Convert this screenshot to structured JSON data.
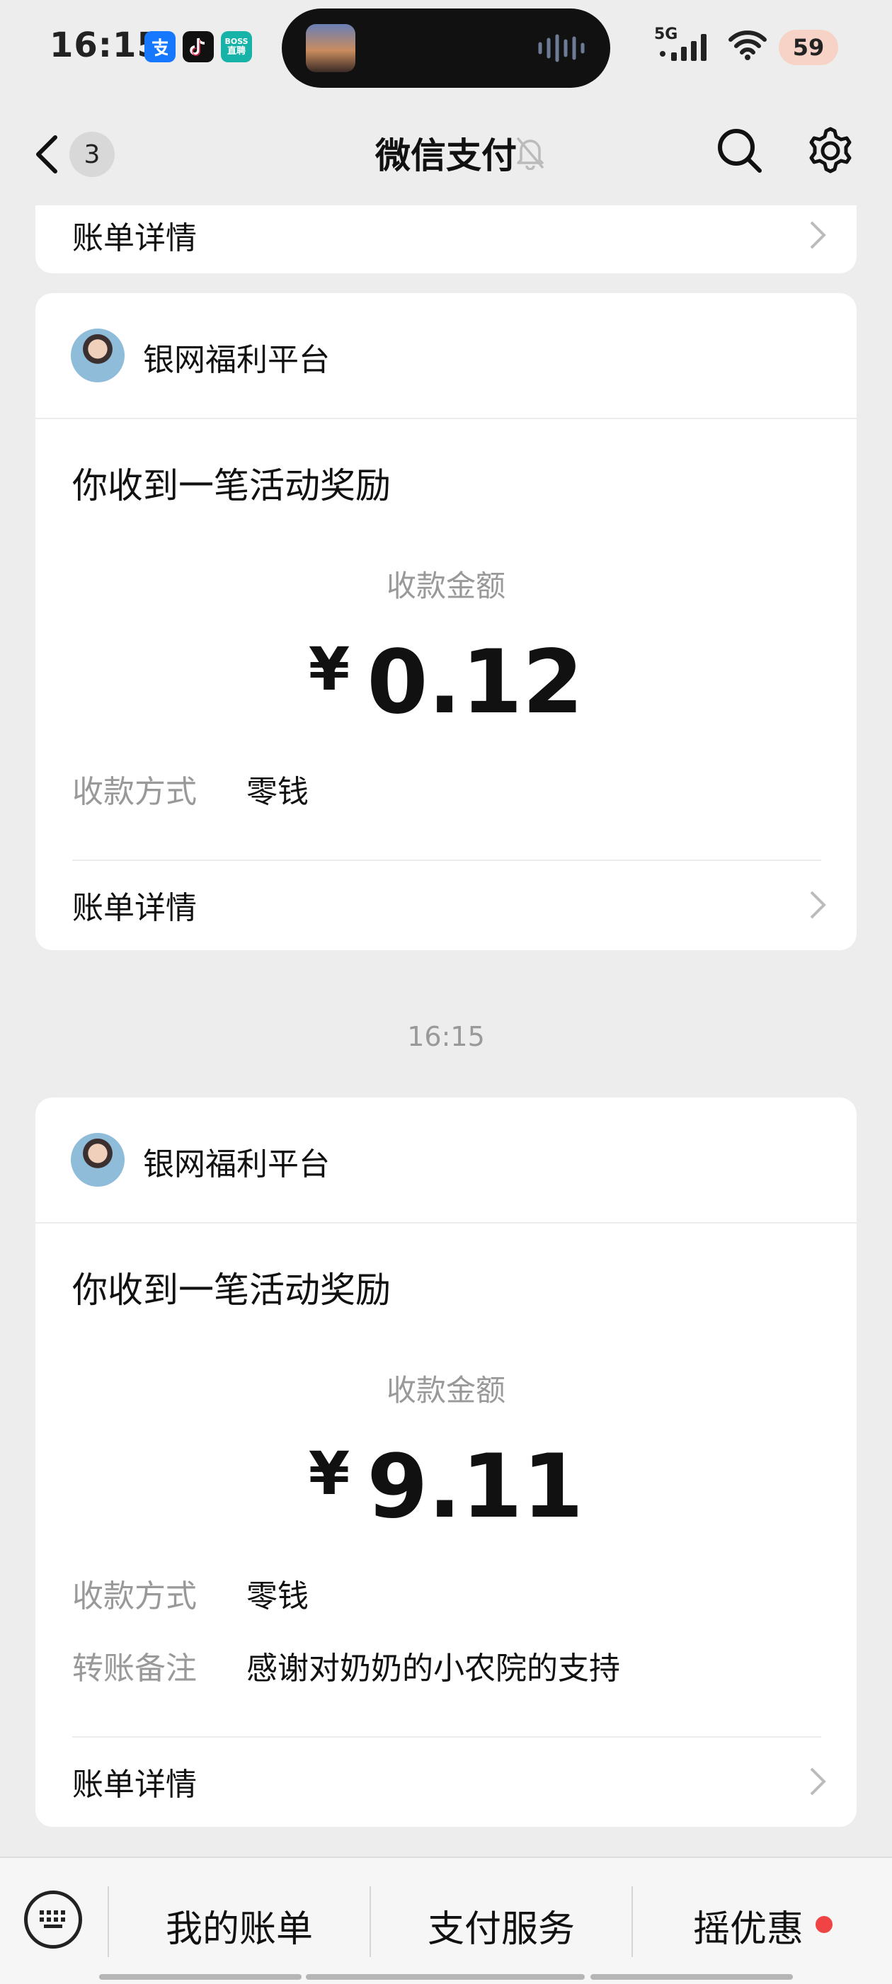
{
  "status_bar": {
    "time": "16:15",
    "apps": [
      "alipay-icon",
      "douyin-icon",
      "boss-zhipin-icon"
    ],
    "boss_line1": "BOSS",
    "boss_line2": "直聘",
    "network": "5G",
    "battery": "59"
  },
  "nav": {
    "unread_count": "3",
    "title": "微信支付"
  },
  "cards": [
    {
      "bill_details": "账单详情"
    },
    {
      "sender": "银网福利平台",
      "title": "你收到一笔活动奖励",
      "amount_label": "收款金额",
      "currency": "¥",
      "amount": "0.12",
      "method_label": "收款方式",
      "method_value": "零钱",
      "bill_details": "账单详情"
    },
    {
      "sender": "银网福利平台",
      "title": "你收到一笔活动奖励",
      "amount_label": "收款金额",
      "currency": "¥",
      "amount": "9.11",
      "method_label": "收款方式",
      "method_value": "零钱",
      "note_label": "转账备注",
      "note_value": "感谢对奶奶的小农院的支持",
      "bill_details": "账单详情"
    }
  ],
  "timestamp": "16:15",
  "bottom_menu": [
    "我的账单",
    "支付服务",
    "摇优惠"
  ],
  "colors": {
    "background": "#ededed",
    "card": "#ffffff",
    "muted_text": "#999999",
    "badge_dot": "#f04343"
  }
}
